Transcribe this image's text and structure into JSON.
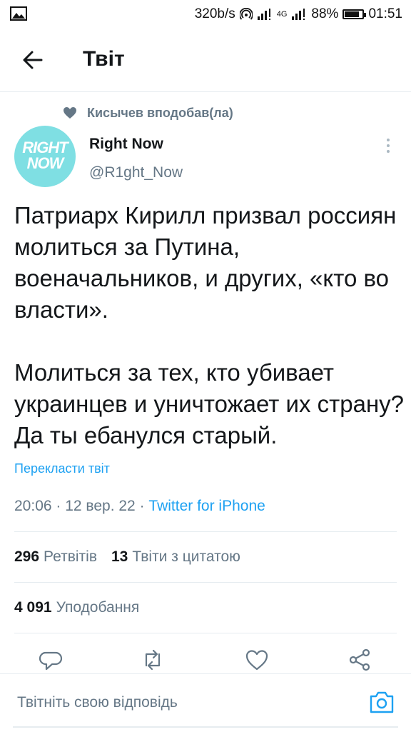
{
  "status_bar": {
    "speed": "320b/s",
    "network": "4G",
    "battery_percent": "88%",
    "battery_level": 0.88,
    "time": "01:51"
  },
  "app_bar": {
    "title": "Твіт"
  },
  "social_context": {
    "text": "Кисычев вподобав(ла)"
  },
  "author": {
    "name": "Right Now",
    "handle": "@R1ght_Now",
    "avatar_line1": "RIGHT",
    "avatar_line2": "NOW",
    "avatar_color": "#7fdfe3"
  },
  "tweet": {
    "text": "Патриарх Кирилл призвал россиян молиться за Путина, военачальников, и других, «кто во власти».\n\nМолиться за тех, кто убивает украинцев и уничтожает их страну? Да ты ебанулся старый.",
    "translate_label": "Перекласти твіт",
    "time": "20:06",
    "date": "12 вер. 22",
    "client": "Twitter for iPhone"
  },
  "stats": {
    "retweets_count": "296",
    "retweets_label": "Ретвітів",
    "quotes_count": "13",
    "quotes_label": "Твіти з цитатою",
    "likes_count": "4 091",
    "likes_label": "Уподобання"
  },
  "reply": {
    "placeholder": "Твітніть свою відповідь"
  },
  "colors": {
    "accent": "#1da1f2",
    "secondary_text": "#657786",
    "divider": "#e6ecf0"
  }
}
